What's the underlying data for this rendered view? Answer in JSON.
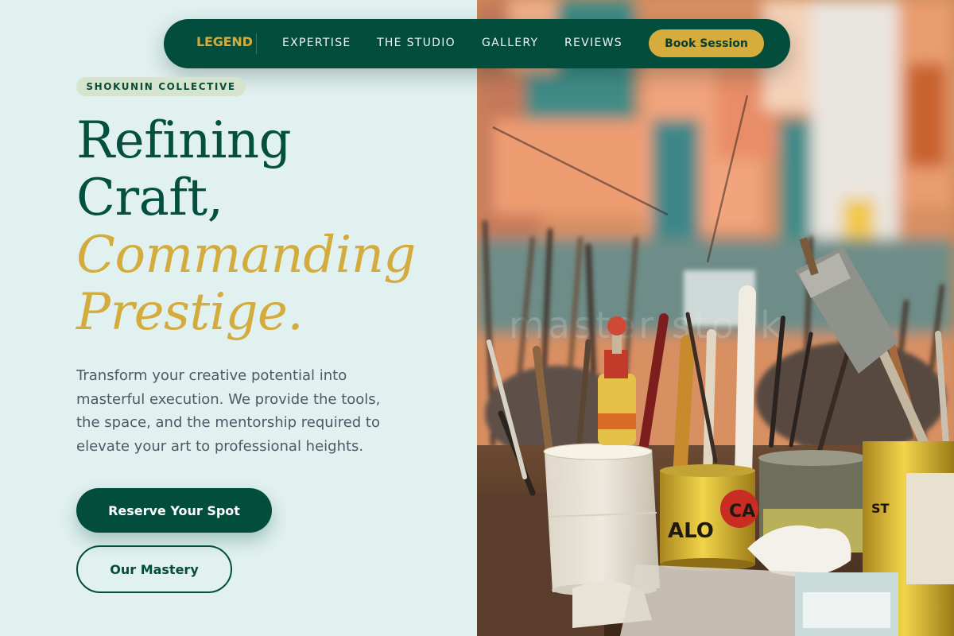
{
  "nav": {
    "logo": "LEGEND",
    "links": [
      "EXPERTISE",
      "THE STUDIO",
      "GALLERY",
      "REVIEWS"
    ],
    "cta_label": "Book Session"
  },
  "hero": {
    "badge": "SHOKUNIN COLLECTIVE",
    "headline_lines": [
      "Refining",
      "Craft,"
    ],
    "headline_accent_lines": [
      "Commanding",
      "Prestige."
    ],
    "description": "Transform your creative potential into masterful execution. We provide the tools, the space, and the mentorship required to elevate your art to professional heights.",
    "primary_button": "Reserve Your Spot",
    "secondary_button": "Our Mastery"
  },
  "colors": {
    "background": "#e0f1ef",
    "brand_green": "#034d3d",
    "accent_gold": "#d6ad3c",
    "text_muted": "#4a5a67"
  }
}
